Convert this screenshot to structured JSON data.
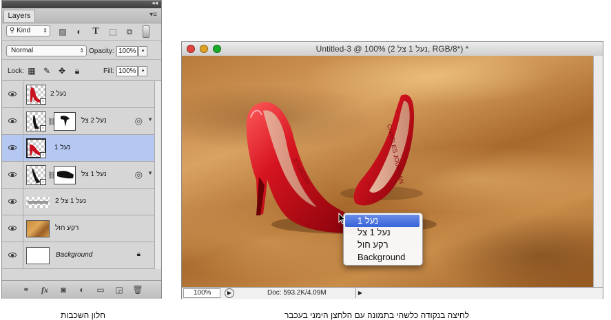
{
  "layers_panel": {
    "tab_label": "Layers",
    "filter_kind": "Kind",
    "blend_mode": "Normal",
    "opacity_label": "Opacity:",
    "opacity_value": "100%",
    "lock_label": "Lock:",
    "fill_label": "Fill:",
    "fill_value": "100%",
    "layers": [
      {
        "name": "נעל 2",
        "type": "smart-object",
        "thumb": "red-shoe"
      },
      {
        "name": "נעל 2 צל",
        "type": "smart-object-masked",
        "thumb": "shadow",
        "has_fx": true
      },
      {
        "name": "נעל 1",
        "type": "smart-object",
        "thumb": "red-shoe",
        "selected": true
      },
      {
        "name": "נעל 1 צל",
        "type": "smart-object-masked",
        "thumb": "shadow",
        "has_fx": true
      },
      {
        "name": "נעל 1 צל 2",
        "type": "raster",
        "thumb": "shadow-strip"
      },
      {
        "name": "רקע חול",
        "type": "raster",
        "thumb": "sand"
      },
      {
        "name": "Background",
        "type": "background",
        "thumb": "white",
        "locked": true
      }
    ],
    "footer_icons": [
      "link-icon",
      "fx-icon",
      "mask-icon",
      "adjustment-icon",
      "folder-icon",
      "new-layer-icon",
      "trash-icon"
    ]
  },
  "document": {
    "title": "Untitled-3 @ 100% (נעל 1 צל 2, RGB/8*) *",
    "zoom": "100%",
    "doc_info": "Doc: 593.2K/4.09M",
    "traffic_colors": [
      "#e0443e",
      "#dea123",
      "#1aab29"
    ]
  },
  "context_menu": {
    "items": [
      {
        "label": "נעל 1",
        "highlighted": true
      },
      {
        "label": "נעל 1 צל",
        "highlighted": false
      },
      {
        "label": "רקע חול",
        "highlighted": false
      },
      {
        "label": "Background",
        "highlighted": false
      }
    ]
  },
  "shoe_brand_text": "CHARLES JOURDAN",
  "captions": {
    "left": "חלון השכבות",
    "right": "לחיצה בנקודה כלשהי בתמונה עם הלחצן הימני בעכבר"
  },
  "colors": {
    "accent_selected": "#b4c8f2",
    "menu_highlight": "#3763d8",
    "shoe_red": "#c8101e"
  }
}
